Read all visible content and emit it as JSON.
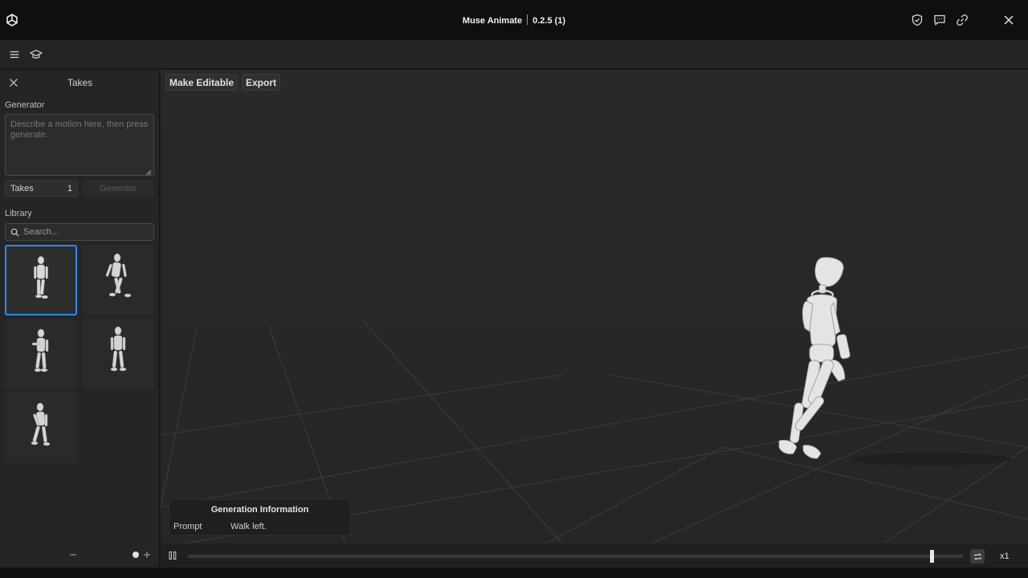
{
  "titlebar": {
    "app_name": "Muse Animate",
    "version": "0.2.5 (1)"
  },
  "sidebar": {
    "title": "Takes",
    "generator_label": "Generator",
    "prompt_placeholder": "Describe a motion here, then press generate.",
    "takes_label": "Takes",
    "takes_count": "1",
    "generate_label": "Generate",
    "library_label": "Library",
    "search_placeholder": "Search...",
    "library_items": 5,
    "selected_index": 0
  },
  "viewport": {
    "make_editable_label": "Make Editable",
    "export_label": "Export",
    "gen_info": {
      "title": "Generation Information",
      "prompt_key": "Prompt",
      "prompt_value": "Walk left."
    }
  },
  "timeline": {
    "progress": 0.96,
    "speed_label": "x1"
  },
  "colors": {
    "accent": "#2a8cf0",
    "background": "#292929",
    "panel": "#252525"
  }
}
